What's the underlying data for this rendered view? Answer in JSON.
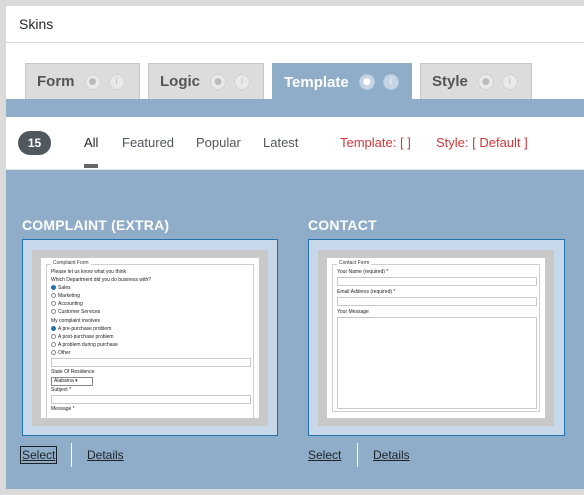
{
  "window": {
    "title": "Skins"
  },
  "tabs": [
    {
      "label": "Form",
      "active": false
    },
    {
      "label": "Logic",
      "active": false
    },
    {
      "label": "Template",
      "active": true
    },
    {
      "label": "Style",
      "active": false
    }
  ],
  "filters": {
    "count": "15",
    "items": [
      "All",
      "Featured",
      "Popular",
      "Latest"
    ],
    "current": "All",
    "template_status": "Template: [  ]",
    "style_status": "Style: [ Default ]"
  },
  "skins": [
    {
      "title": "COMPLAINT (EXTRA)",
      "select_label": "Select",
      "details_label": "Details",
      "preview": {
        "legend": "Complaint Form",
        "lines": [
          "Please let us know what you think",
          "Which Department did you do business with?"
        ],
        "departments": [
          "Sales",
          "Marketing",
          "Accounting",
          "Customer Services"
        ],
        "involves_label": "My complaint involves",
        "involves": [
          "A pre-purchase problem",
          "A post-purchase problem",
          "A problem during purchase",
          "Other"
        ],
        "state_label": "State Of Residence",
        "state_value": "Alabama",
        "subject_label": "Subject *",
        "message_label": "Message *"
      }
    },
    {
      "title": "CONTACT",
      "select_label": "Select",
      "details_label": "Details",
      "preview": {
        "legend": "Contact Form",
        "name_label": "Your Name (required) *",
        "email_label": "Email Address (required) *",
        "message_label": "Your Message"
      }
    }
  ],
  "colors": {
    "accent": "#8fadc9",
    "status_red": "#d63638",
    "selection_border": "#2271b1"
  }
}
